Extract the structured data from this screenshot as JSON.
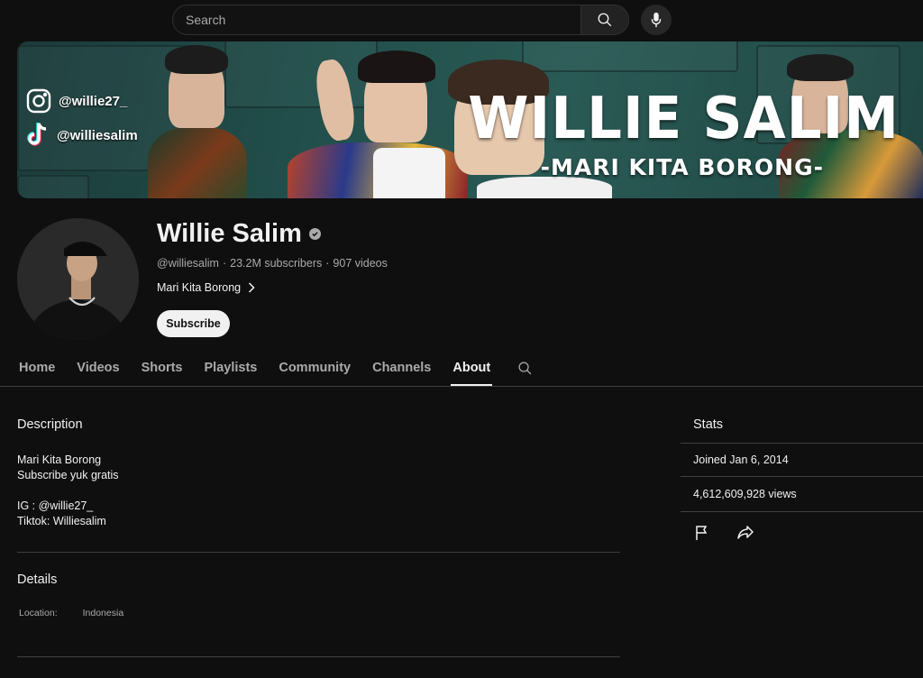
{
  "search": {
    "placeholder": "Search"
  },
  "banner": {
    "instagram_handle": "@willie27_",
    "tiktok_handle": "@williesalim",
    "title": "WILLIE SALIM",
    "subtitle": "-MARI KITA BORONG-"
  },
  "channel": {
    "name": "Willie Salim",
    "handle": "@williesalim",
    "separator": "·",
    "subscribers": "23.2M subscribers",
    "videos": "907 videos",
    "tagline": "Mari Kita Borong",
    "subscribe_label": "Subscribe"
  },
  "tabs": [
    {
      "label": "Home"
    },
    {
      "label": "Videos"
    },
    {
      "label": "Shorts"
    },
    {
      "label": "Playlists"
    },
    {
      "label": "Community"
    },
    {
      "label": "Channels"
    },
    {
      "label": "About",
      "active": true
    }
  ],
  "about": {
    "description_title": "Description",
    "description_lines": [
      "Mari Kita Borong",
      "Subscribe yuk gratis",
      "",
      "IG : @willie27_",
      "Tiktok: Williesalim"
    ],
    "details_title": "Details",
    "location_label": "Location:",
    "location_value": "Indonesia"
  },
  "stats": {
    "title": "Stats",
    "joined": "Joined Jan 6, 2014",
    "views": "4,612,609,928 views"
  },
  "icons": {
    "search": "search-icon",
    "mic": "microphone-icon",
    "flag": "flag-icon",
    "share": "share-icon",
    "verified": "verified-check-icon"
  }
}
